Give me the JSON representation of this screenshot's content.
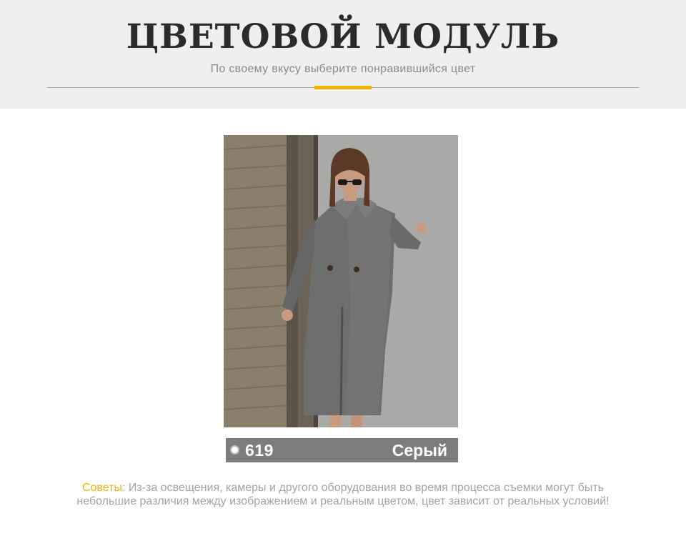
{
  "header": {
    "title": "ЦВЕТОВОЙ МОДУЛЬ",
    "subtitle": "По своему вкусу выберите понравившийся цвет"
  },
  "product": {
    "image_alt": "Серое пальто",
    "color_code": "619",
    "color_name": "Серый"
  },
  "tips": {
    "label": "Советы:",
    "text": " Из-за освещения, камеры и другого оборудования во время процесса съемки могут быть небольшие различия между изображением и реальным цветом, цвет зависит от реальных условий!"
  },
  "colors": {
    "accent": "#f0b400",
    "header_bg": "#efefef",
    "label_bar": "#7d7d7d",
    "coat": "#6f6f6f"
  }
}
